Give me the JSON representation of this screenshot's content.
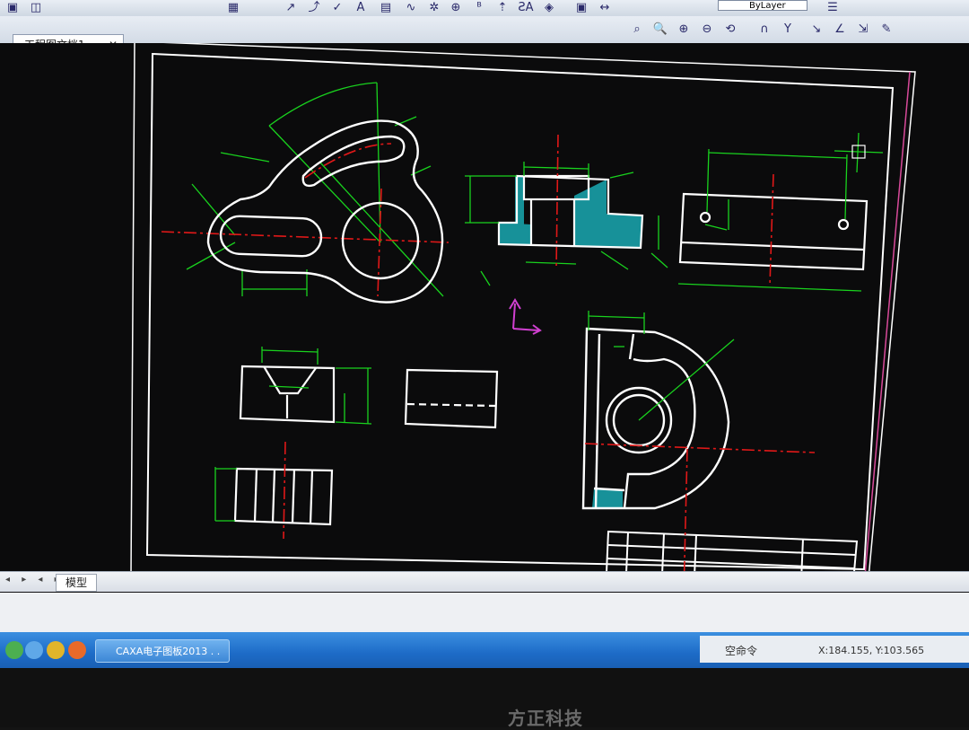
{
  "toolbar": {
    "linetype_value": "ByLayer"
  },
  "document": {
    "tab_title": "工程图文档1",
    "tab_close": "✕"
  },
  "sheet_tabs": {
    "nav_arrows": "◂ ▸ ◂ ▸",
    "model_tab": "模型"
  },
  "taskbar": {
    "app_button": "CAXA电子图板2013 . ."
  },
  "status_bar": {
    "command": "空命令",
    "coordinates": "X:184.155, Y:103.565"
  },
  "monitor": {
    "brand": "方正科技"
  },
  "colors": {
    "outline": "#ffffff",
    "dimension": "#19d21e",
    "centerline": "#e01818",
    "hatch": "#18a0a8",
    "axis_icon": "#d040d0"
  }
}
